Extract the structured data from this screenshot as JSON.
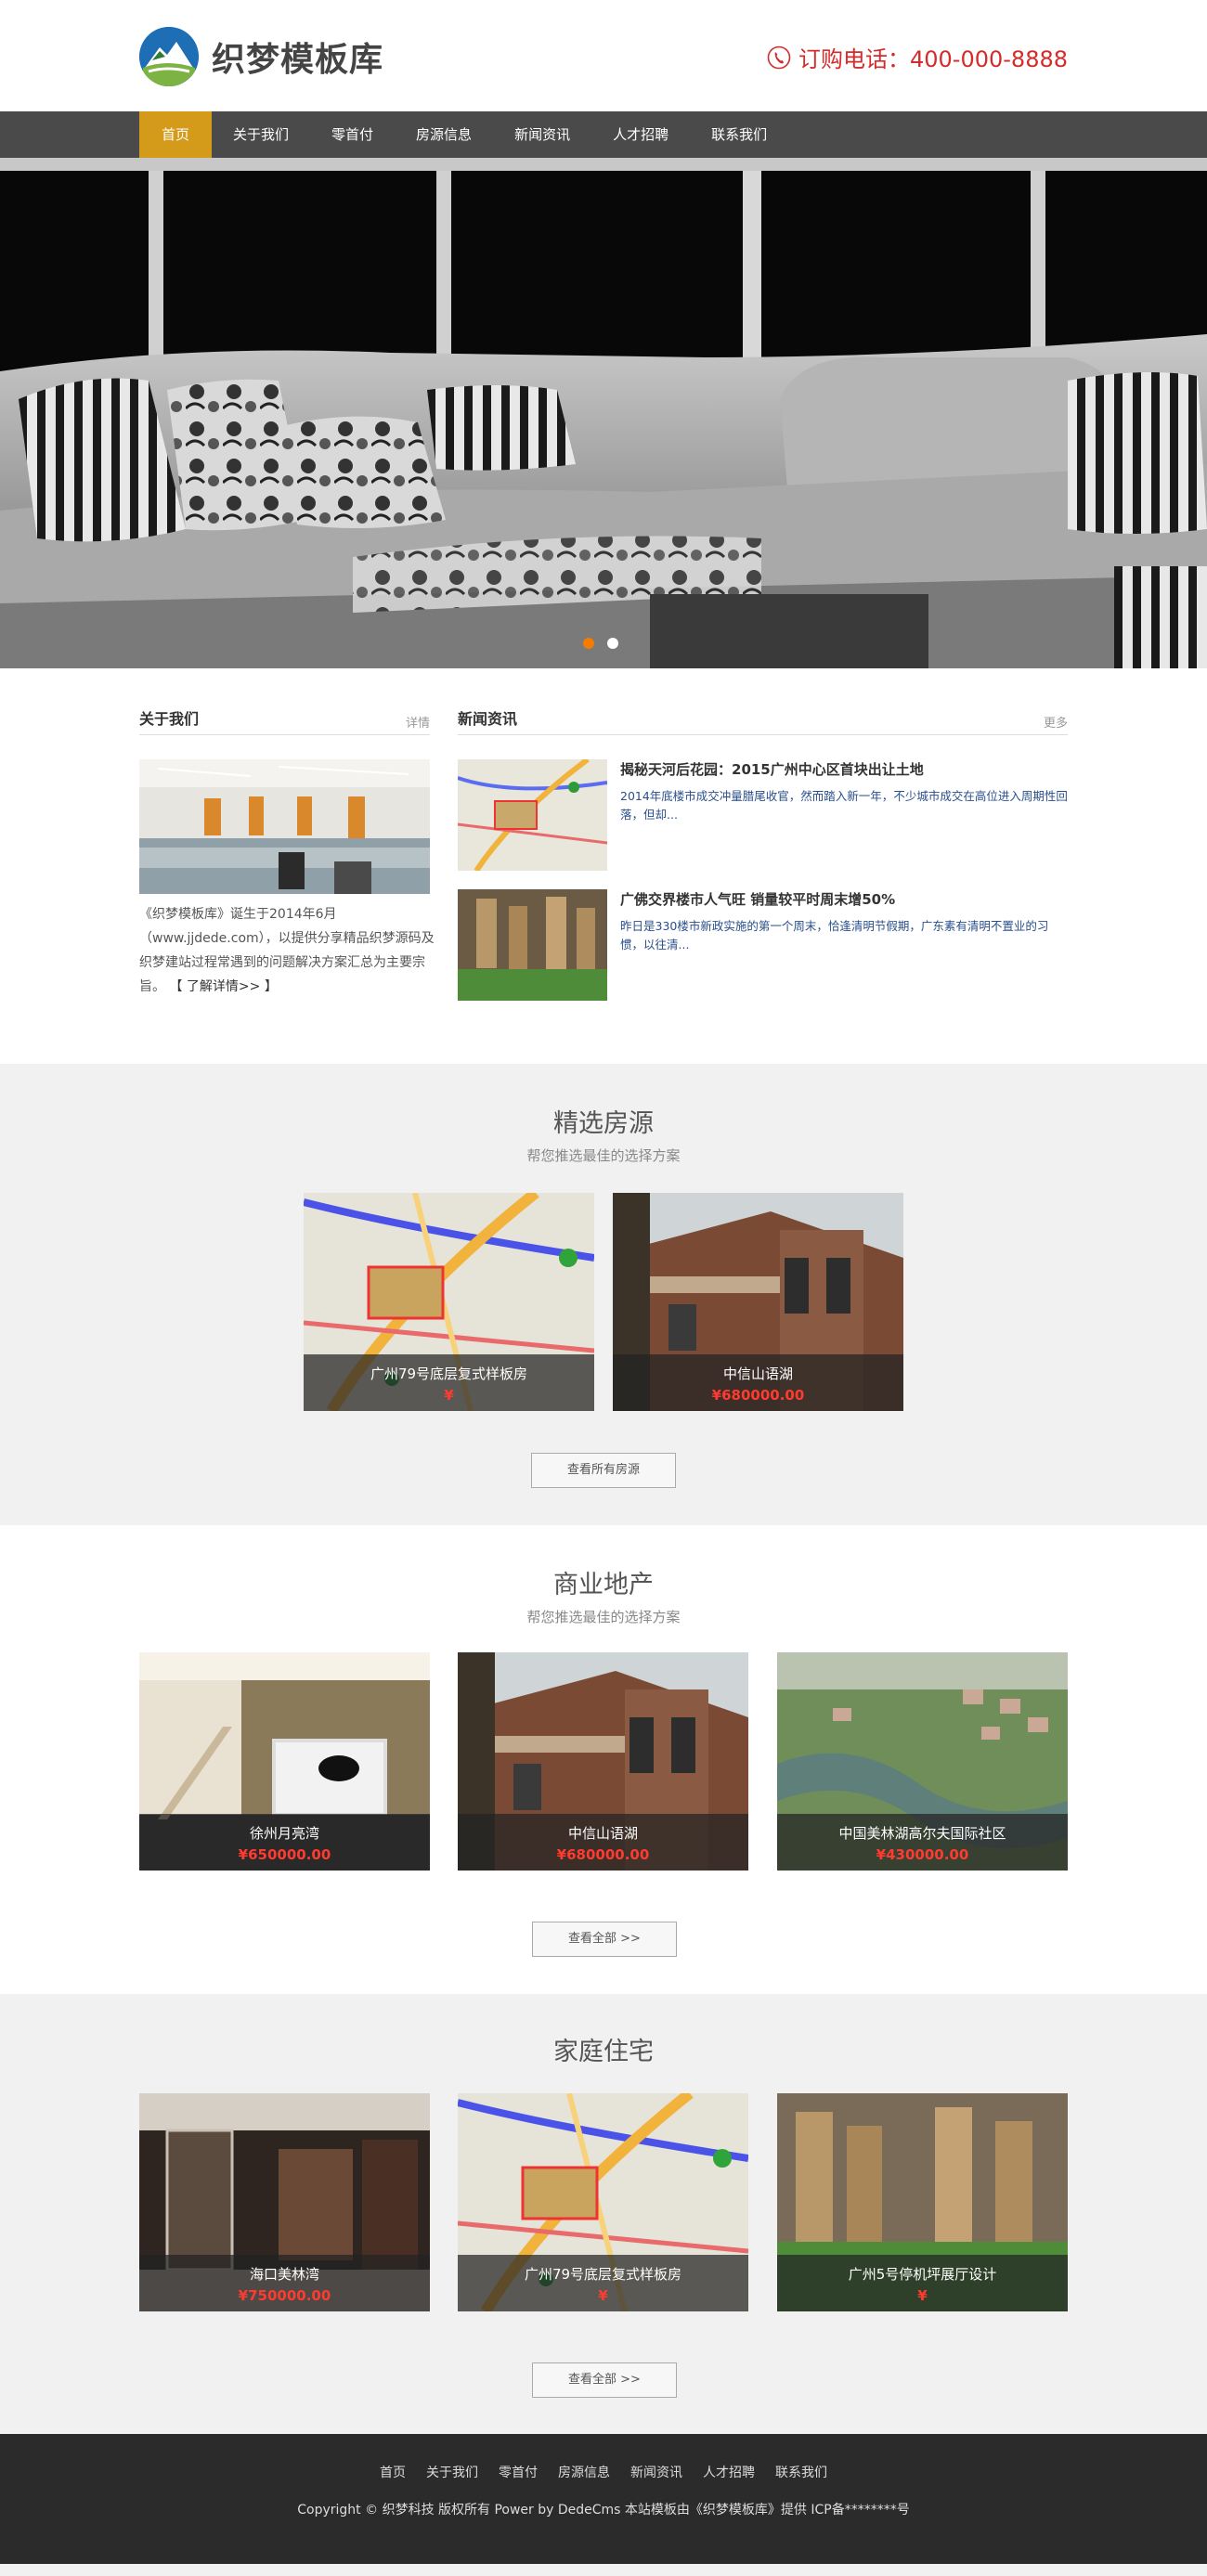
{
  "header": {
    "logo_text": "织梦模板库",
    "hotline": "订购电话：400-000-8888",
    "phone_icon": "phone-icon"
  },
  "nav": {
    "items": [
      {
        "label": "首页",
        "active": true
      },
      {
        "label": "关于我们"
      },
      {
        "label": "零首付"
      },
      {
        "label": "房源信息"
      },
      {
        "label": "新闻资讯"
      },
      {
        "label": "人才招聘"
      },
      {
        "label": "联系我们"
      }
    ]
  },
  "banner": {
    "active_dot": 0,
    "dot_count": 2
  },
  "about": {
    "title": "关于我们",
    "more": "详情",
    "text": "《织梦模板库》诞生于2014年6月（www.jjdede.com），以提供分享精品织梦源码及织梦建站过程常遇到的问题解决方案汇总为主要宗旨。",
    "link": "【 了解详情>> 】"
  },
  "news": {
    "title": "新闻资讯",
    "more": "更多",
    "items": [
      {
        "title": "揭秘天河后花园：2015广州中心区首块出让土地",
        "desc": "2014年底楼市成交冲量腊尾收官，然而踏入新一年，不少城市成交在高位进入周期性回落，但却..."
      },
      {
        "title": "广佛交界楼市人气旺 销量较平时周末增50%",
        "desc": "昨日是330楼市新政实施的第一个周末，恰逢清明节假期，广东素有清明不置业的习惯，以往清..."
      }
    ]
  },
  "featured": {
    "title": "精选房源",
    "subtitle": "帮您推选最佳的选择方案",
    "items": [
      {
        "name": "广州79号底层复式样板房",
        "price": "¥"
      },
      {
        "name": "中信山语湖",
        "price": "¥680000.00"
      }
    ],
    "button": "查看所有房源"
  },
  "commercial": {
    "title": "商业地产",
    "subtitle": "帮您推选最佳的选择方案",
    "items": [
      {
        "name": "徐州月亮湾",
        "price": "¥650000.00"
      },
      {
        "name": "中信山语湖",
        "price": "¥680000.00"
      },
      {
        "name": "中国美林湖高尔夫国际社区",
        "price": "¥430000.00"
      }
    ],
    "button": "查看全部 >>"
  },
  "home": {
    "title": "家庭住宅",
    "items": [
      {
        "name": "海口美林湾",
        "price": "¥750000.00"
      },
      {
        "name": "广州79号底层复式样板房",
        "price": "¥"
      },
      {
        "name": "广州5号停机坪展厅设计",
        "price": "¥"
      }
    ],
    "button": "查看全部 >>"
  },
  "footer": {
    "nav": [
      "首页",
      "关于我们",
      "零首付",
      "房源信息",
      "新闻资讯",
      "人才招聘",
      "联系我们"
    ],
    "copyright": "Copyright © 织梦科技 版权所有 Power by DedeCms 本站模板由《织梦模板库》提供 ICP备********号"
  },
  "colors": {
    "nav_bg": "#4a4a4a",
    "nav_active": "#d49a1a",
    "hotline": "#d62b2b",
    "price": "#ff3b30",
    "footer_bg": "#2b2b2b",
    "section_gray": "#f1f1f1"
  }
}
